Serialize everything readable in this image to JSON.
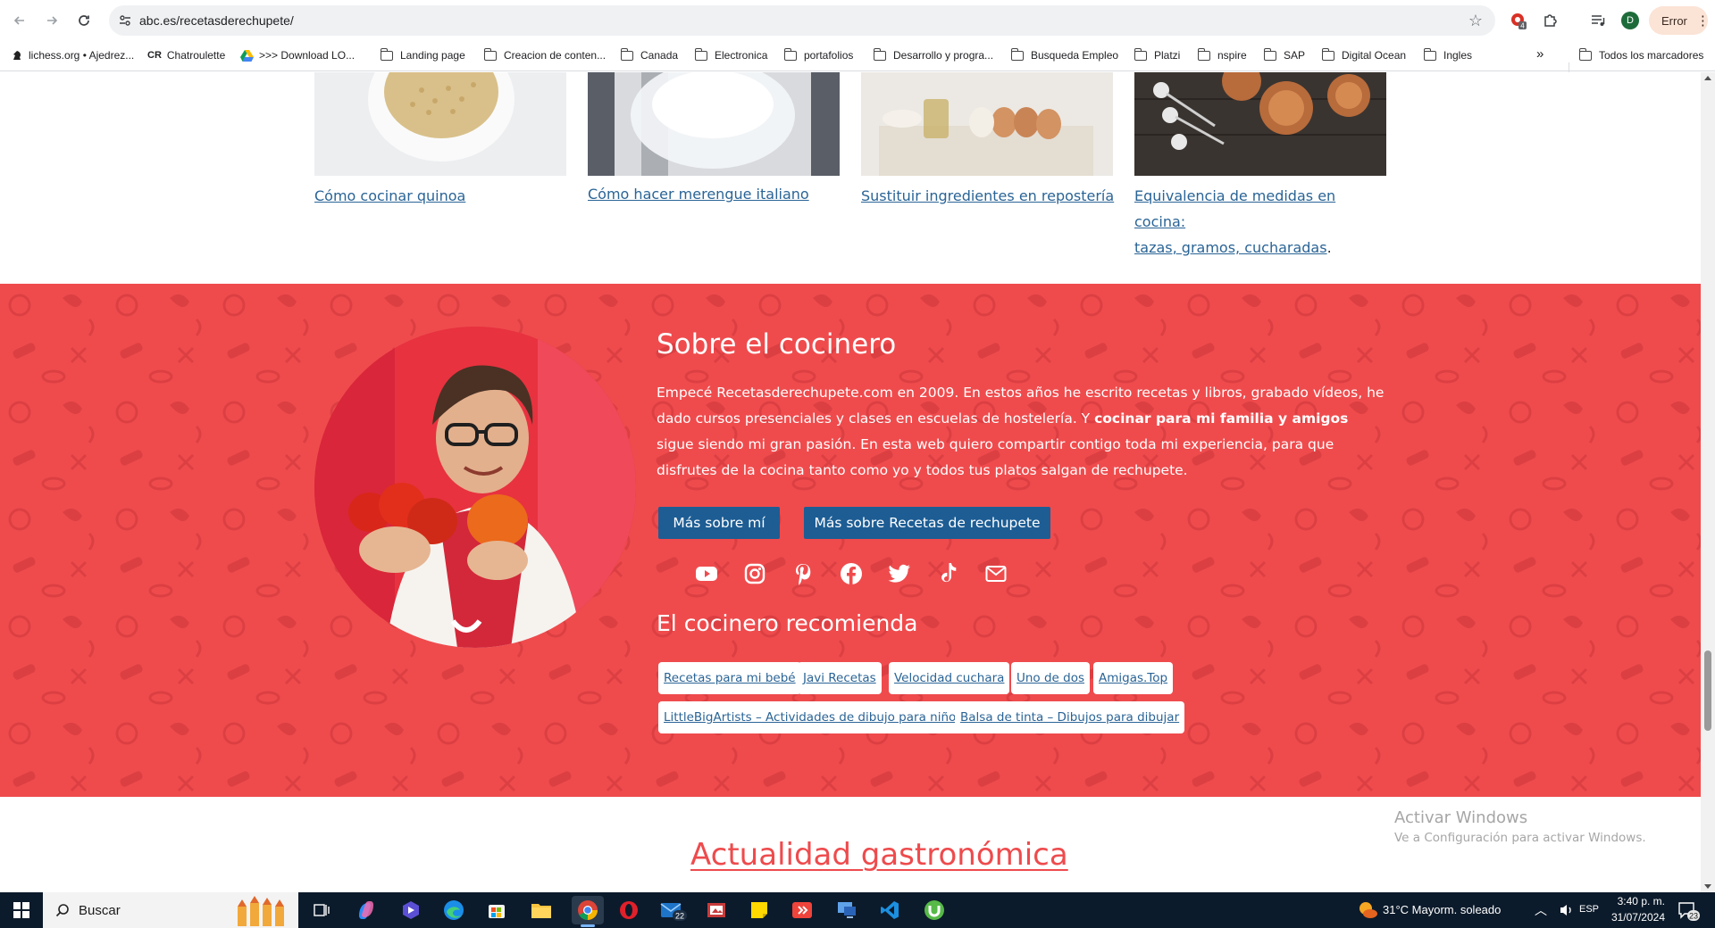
{
  "browser": {
    "url": "abc.es/recetasderechupete/",
    "error_label": "Error",
    "profile_initial": "D",
    "extension_badge": "4"
  },
  "bookmarks": [
    {
      "label": "lichess.org • Ajedrez...",
      "icon": "lichess-icon"
    },
    {
      "label": "Chatroulette",
      "icon": "cr-icon",
      "prefix": "CR"
    },
    {
      "label": ">>> Download LO...",
      "icon": "drive-icon"
    },
    {
      "label": "Landing page",
      "icon": "folder-icon"
    },
    {
      "label": "Creacion de conten...",
      "icon": "folder-icon"
    },
    {
      "label": "Canada",
      "icon": "folder-icon"
    },
    {
      "label": "Electronica",
      "icon": "folder-icon"
    },
    {
      "label": "portafolios",
      "icon": "folder-icon"
    },
    {
      "label": "Desarrollo y progra...",
      "icon": "folder-icon"
    },
    {
      "label": "Busqueda Empleo",
      "icon": "folder-icon"
    },
    {
      "label": "Platzi",
      "icon": "folder-icon"
    },
    {
      "label": "nspire",
      "icon": "folder-icon"
    },
    {
      "label": "SAP",
      "icon": "folder-icon"
    },
    {
      "label": "Digital Ocean",
      "icon": "folder-icon"
    },
    {
      "label": "Ingles",
      "icon": "folder-icon"
    }
  ],
  "bookmarks_overflow": "»",
  "all_bookmarks": "Todos los marcadores",
  "cards": [
    {
      "title": "Cómo cocinar quinoa"
    },
    {
      "title": "Cómo hacer merengue italiano"
    },
    {
      "title": "Sustituir ingredientes en repostería"
    },
    {
      "title_line1": "Equivalencia de medidas en cocina:",
      "title_line2": "tazas, gramos, cucharadas",
      "suffix": "."
    }
  ],
  "about": {
    "heading": "Sobre el cocinero",
    "bio_part1": "Empecé Recetasderechupete.com en 2009. En estos años he escrito recetas y libros, grabado vídeos, he dado cursos presenciales y clases en escuelas de hostelería. Y ",
    "bio_bold": "cocinar para mi familia y amigos",
    "bio_part2": " sigue siendo mi gran pasión. En esta web quiero compartir contigo toda mi experiencia, para que disfrutes de la cocina tanto como yo y todos tus platos salgan de rechupete.",
    "btn_more_me": "Más sobre mí",
    "btn_more_site": "Más sobre Recetas de rechupete",
    "social": [
      "youtube-icon",
      "instagram-icon",
      "pinterest-icon",
      "facebook-icon",
      "twitter-icon",
      "tiktok-icon",
      "mail-icon"
    ],
    "recommends_heading": "El cocinero recomienda",
    "recommendations": [
      "Recetas para mi bebé",
      "Javi Recetas",
      "Velocidad cuchara",
      "Uno de dos",
      "Amigas.Top",
      "LittleBigArtists – Actividades de dibujo para niños",
      "Balsa de tinta – Dibujos para dibujar"
    ]
  },
  "watermark": {
    "line1": "Activar Windows",
    "line2": "Ve a Configuración para activar Windows."
  },
  "next_section_title": "Actualidad gastronómica",
  "taskbar": {
    "search_placeholder": "Buscar",
    "weather": "31°C  Mayorm. soleado",
    "language": "ESP",
    "time": "3:40 p. m.",
    "date": "31/07/2024",
    "mail_badge": "22",
    "notification_badge": "23"
  },
  "colors": {
    "accent_red": "#ef4b4d",
    "button_blue": "#1d5d94",
    "link_blue": "#2a6496"
  }
}
